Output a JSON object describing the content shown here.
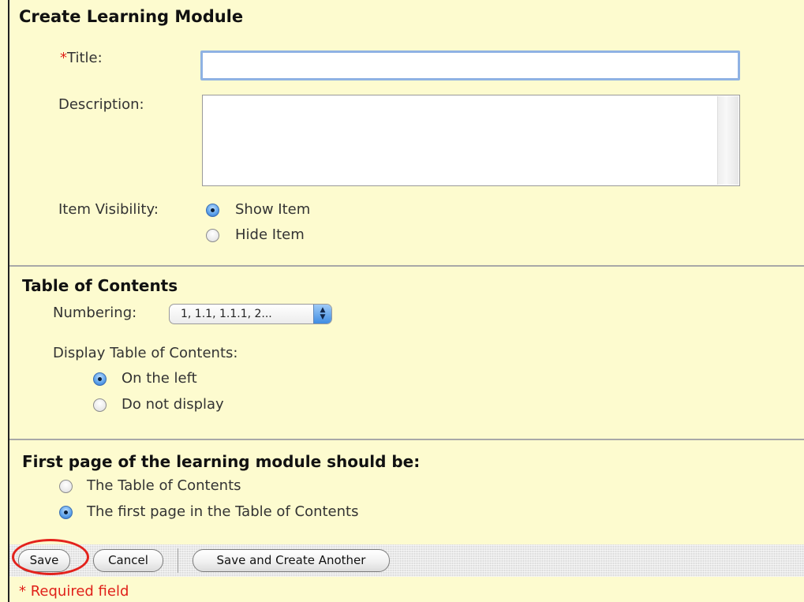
{
  "form": {
    "title": "Create Learning Module",
    "title_field": {
      "required_mark": "*",
      "label": "Title:",
      "value": ""
    },
    "description_field": {
      "label": "Description:",
      "value": ""
    },
    "item_visibility": {
      "label": "Item Visibility:",
      "options": [
        {
          "label": "Show Item",
          "selected": true
        },
        {
          "label": "Hide Item",
          "selected": false
        }
      ]
    }
  },
  "toc": {
    "heading": "Table of Contents",
    "numbering_label": "Numbering:",
    "numbering_value": "1, 1.1, 1.1.1, 2...",
    "display_label": "Display Table of Contents:",
    "display_options": [
      {
        "label": "On the left",
        "selected": true
      },
      {
        "label": "Do not display",
        "selected": false
      }
    ]
  },
  "first_page": {
    "heading": "First page of the learning module should be:",
    "options": [
      {
        "label": "The Table of Contents",
        "selected": false
      },
      {
        "label": "The first page in the Table of Contents",
        "selected": true
      }
    ]
  },
  "actions": {
    "save": "Save",
    "cancel": "Cancel",
    "save_and_create": "Save and Create Another"
  },
  "footer": {
    "required_note": "* Required field"
  },
  "colors": {
    "background": "#fdfbcf",
    "required": "#e0201a",
    "highlight_ring": "#e3221c"
  }
}
